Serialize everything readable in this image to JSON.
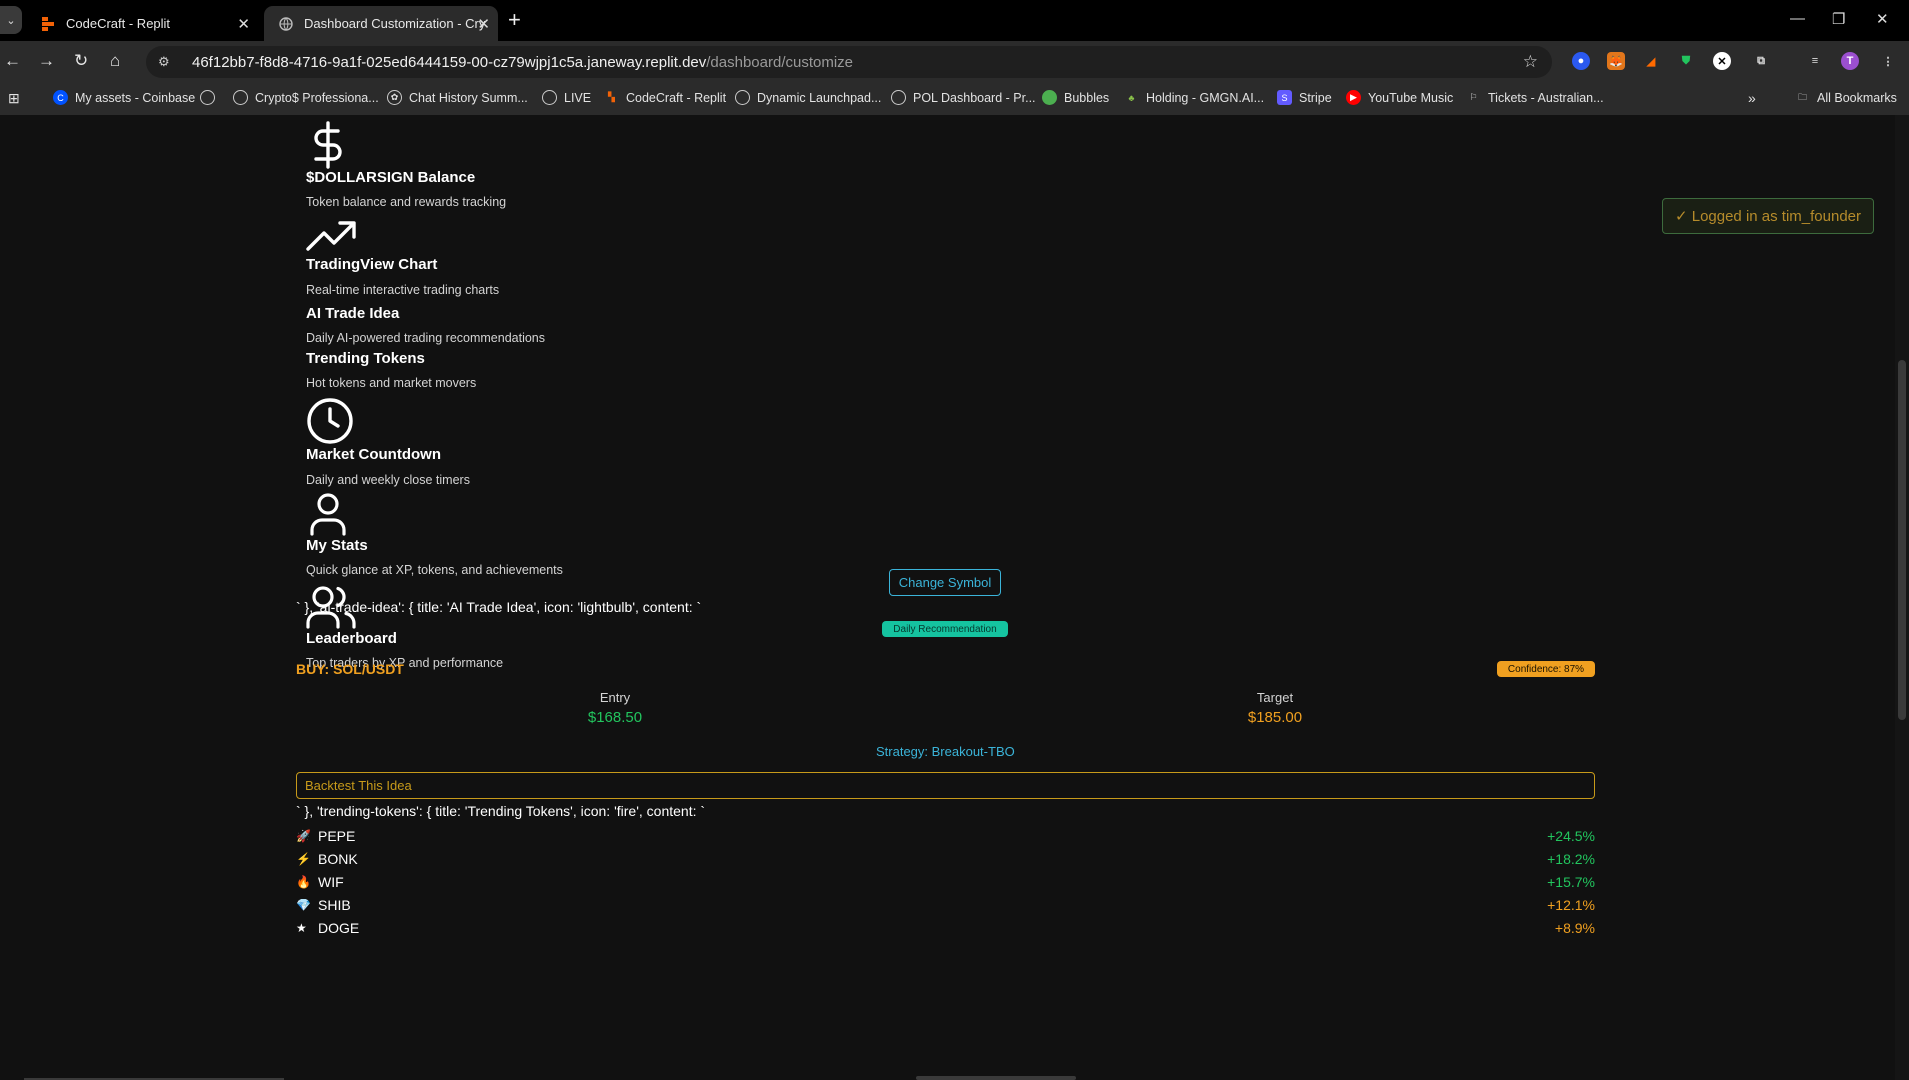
{
  "browser": {
    "tabs": [
      {
        "title": "CodeCraft - Replit"
      },
      {
        "title": "Dashboard Customization - Cry"
      }
    ],
    "url_host": "46f12bb7-f8d8-4716-9a1f-025ed6444159-00-cz79wjpj1c5a.janeway.replit.dev",
    "url_path": "/dashboard/customize",
    "profile_initial": "T",
    "bookmarks": [
      "My assets - Coinbase",
      "",
      "Crypto$ Professiona...",
      "Chat History Summ...",
      "LIVE",
      "CodeCraft - Replit",
      "Dynamic Launchpad...",
      "POL Dashboard - Pr...",
      "Bubbles",
      "Holding - GMGN.AI...",
      "Stripe",
      "YouTube Music",
      "Tickets - Australian..."
    ],
    "all_bookmarks": "All Bookmarks"
  },
  "widgets": [
    {
      "icon": "dollar-sign-icon",
      "title": "$DOLLARSIGN Balance",
      "desc": "Token balance and rewards tracking"
    },
    {
      "icon": "trending-up-icon",
      "title": "TradingView Chart",
      "desc": "Real-time interactive trading charts"
    },
    {
      "icon": "",
      "title": "AI Trade Idea",
      "desc": "Daily AI-powered trading recommendations"
    },
    {
      "icon": "",
      "title": "Trending Tokens",
      "desc": "Hot tokens and market movers"
    },
    {
      "icon": "clock-icon",
      "title": "Market Countdown",
      "desc": "Daily and weekly close timers"
    },
    {
      "icon": "user-icon",
      "title": "My Stats",
      "desc": "Quick glance at XP, tokens, and achievements"
    },
    {
      "icon": "users-icon",
      "title": "Leaderboard",
      "desc": "Top traders by XP and performance"
    }
  ],
  "logged_in": "✓ Logged in as tim_founder",
  "change_symbol": "Change Symbol",
  "raw_ai_trade": "` }, 'ai-trade-idea': { title: 'AI Trade Idea', icon: 'lightbulb', content: `",
  "daily_recommendation": "Daily Recommendation",
  "trade": {
    "pair": "BUY: SOL/USDT",
    "confidence": "Confidence: 87%",
    "entry_label": "Entry",
    "entry_value": "$168.50",
    "target_label": "Target",
    "target_value": "$185.00",
    "strategy": "Strategy: Breakout-TBO",
    "backtest": "Backtest This Idea"
  },
  "raw_trending": "` }, 'trending-tokens': { title: 'Trending Tokens', icon: 'fire', content: `",
  "tokens": [
    {
      "emoji": "🚀",
      "name": "PEPE",
      "change": "+24.5%",
      "color": "#22c55e"
    },
    {
      "emoji": "⚡",
      "name": "BONK",
      "change": "+18.2%",
      "color": "#22c55e"
    },
    {
      "emoji": "🔥",
      "name": "WIF",
      "change": "+15.7%",
      "color": "#22c55e"
    },
    {
      "emoji": "💎",
      "name": "SHIB",
      "change": "+12.1%",
      "color": "#f0a020"
    },
    {
      "emoji": "★",
      "name": "DOGE",
      "change": "+8.9%",
      "color": "#f0a020"
    }
  ],
  "colors": {
    "green": "#22c55e",
    "orange": "#f0a020",
    "cyan": "#3bb4d9",
    "gold": "#c79a1a"
  }
}
